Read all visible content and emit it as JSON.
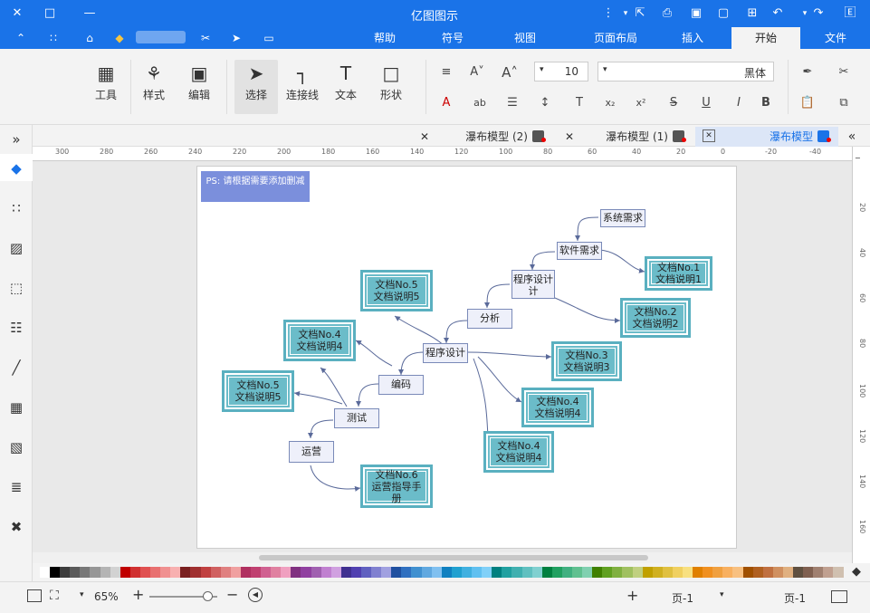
{
  "app": {
    "title": "亿图图示",
    "brand_color": "#1a73e8"
  },
  "menu": {
    "tabs": [
      "文件",
      "开始",
      "插入",
      "页面布局",
      "视图",
      "符号",
      "帮助"
    ],
    "active": "开始"
  },
  "ribbon": {
    "font_name": "黑体",
    "font_size": "10",
    "buttons": {
      "select": "选择",
      "connector": "连接线",
      "text": "文本",
      "shape": "形状",
      "edit": "编辑",
      "style": "样式",
      "tools": "工具"
    },
    "format_buttons": [
      "B",
      "I",
      "U",
      "S",
      "x²",
      "x₂",
      "T",
      "ab"
    ]
  },
  "doc_tabs": [
    {
      "label": "瀑布模型",
      "active": true
    },
    {
      "label": "瀑布模型 (1)",
      "active": false
    },
    {
      "label": "瀑布模型 (2)",
      "active": false
    }
  ],
  "ruler": {
    "h_ticks": [
      "-40",
      "-20",
      "0",
      "20",
      "40",
      "60",
      "80",
      "100",
      "120",
      "140",
      "160",
      "180",
      "200",
      "220",
      "240",
      "260",
      "280",
      "300"
    ],
    "v_ticks": [
      "20",
      "40",
      "60",
      "80",
      "100",
      "120",
      "140",
      "160"
    ]
  },
  "diagram": {
    "note": "PS: 请根据需要添加删减",
    "nodes": {
      "req_system": "系统需求",
      "req_software": "软件需求",
      "program_design": "程序设计",
      "analysis": "分析",
      "detail_design": "程序设计",
      "coding": "编码",
      "testing": "测试",
      "operation": "运营",
      "doc1": [
        "文档No.1",
        "文档说明1"
      ],
      "doc2": [
        "文档No.2",
        "文档说明2"
      ],
      "doc3": [
        "文档No.3",
        "文档说明3"
      ],
      "doc4a": [
        "文档No.4",
        "文档说明4"
      ],
      "doc4b": [
        "文档No.4",
        "文档说明4"
      ],
      "doc4c": [
        "文档No.4",
        "文档说明4"
      ],
      "doc5a": [
        "文档No.5",
        "文档说明5"
      ],
      "doc5b": [
        "文档No.5",
        "文档说明5"
      ],
      "doc6": [
        "文档No.6",
        "运营指导手册"
      ]
    },
    "program_design_top": "程序设计",
    "program_design_bottom": "计"
  },
  "status": {
    "page_selector": "页-1",
    "page_tab": "页-1",
    "zoom": "65%"
  },
  "palette_colors": [
    "#ffffff",
    "#000000",
    "#3c3c3c",
    "#5a5a5a",
    "#787878",
    "#969696",
    "#b4b4b4",
    "#d2d2d2",
    "#c00000",
    "#d03030",
    "#e05050",
    "#e87070",
    "#f09090",
    "#f8b0b0",
    "#7a2020",
    "#a03030",
    "#c04040",
    "#d06060",
    "#e08080",
    "#f0a0a0",
    "#b03060",
    "#c04070",
    "#d06090",
    "#e080a0",
    "#f0a0c0",
    "#803080",
    "#9040a0",
    "#a060b0",
    "#c080d0",
    "#d0a0e0",
    "#403090",
    "#5040b0",
    "#6060c0",
    "#8080d0",
    "#a0a0e0",
    "#2050a0",
    "#3070c0",
    "#4090d0",
    "#60a8e0",
    "#80c0f0",
    "#1080c0",
    "#20a0d0",
    "#40b0e0",
    "#60c0f0",
    "#80d0f8",
    "#008080",
    "#20a0a0",
    "#40b0b0",
    "#60c0c0",
    "#80d0d0",
    "#008040",
    "#20a060",
    "#40b080",
    "#60c090",
    "#80d0b0",
    "#408000",
    "#60a020",
    "#80b040",
    "#a0c060",
    "#c0d080",
    "#c0a000",
    "#d0b020",
    "#e0c040",
    "#f0d060",
    "#f8e080",
    "#e08000",
    "#f09020",
    "#f0a040",
    "#f8b060",
    "#f8c080",
    "#a05000",
    "#b06020",
    "#c07040",
    "#d09060",
    "#e0b080",
    "#605040",
    "#806050",
    "#a08070",
    "#c0a090",
    "#d0c0b0"
  ]
}
